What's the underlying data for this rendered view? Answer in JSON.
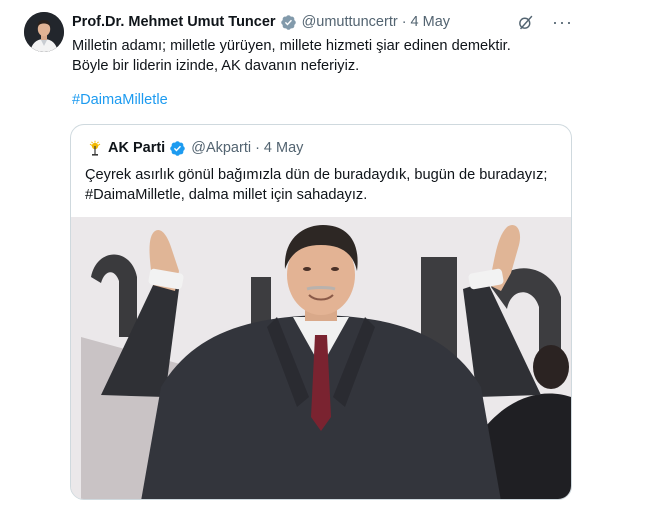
{
  "author": {
    "name": "Prof.Dr. Mehmet Umut Tuncer",
    "handle": "@umuttuncertr",
    "separator": "·",
    "date": "4 May",
    "verified_icon": "verified-badge-icon"
  },
  "tweet": {
    "text": "Milletin adamı; milletle yürüyen, millete hizmeti şiar edinen demektir. Böyle bir liderin izinde, AK davanın neferiyiz.",
    "hashtag": "#DaimaMilletle"
  },
  "header_icons": {
    "grok": "grok-icon",
    "more": "···"
  },
  "quoted_tweet": {
    "name": "AK Parti",
    "handle": "@Akparti",
    "separator": "·",
    "date": "4 May",
    "text": "Çeyrek asırlık gönül bağımızla dün de buradaydık, bugün de buradayız; #DaimaMilletle, dalma millet için sahadayız.",
    "media": "photo-of-politician-waving"
  },
  "colors": {
    "link": "#1d9bf0",
    "muted": "#536471",
    "verified": "#829aab",
    "quote_verified": "#1d9bf0",
    "border": "#cfd9de"
  }
}
